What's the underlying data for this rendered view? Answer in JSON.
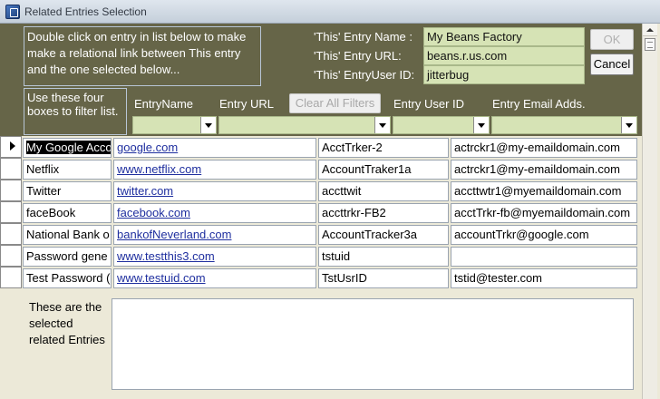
{
  "window": {
    "title": "Related Entries Selection"
  },
  "instructions": "Double click on entry in list below to make make a relational link between This entry and the one selected below...",
  "filter_note": "Use these four boxes to filter list.",
  "entry": {
    "name_label": "'This' Entry Name :",
    "name_value": "My Beans Factory",
    "url_label": "'This' Entry URL:",
    "url_value": "beans.r.us.com",
    "user_label": "'This' EntryUser ID:",
    "user_value": "jitterbug"
  },
  "buttons": {
    "ok": "OK",
    "cancel": "Cancel",
    "clear_filters": "Clear All Filters"
  },
  "columns": {
    "name": "EntryName",
    "url": "Entry URL",
    "user": "Entry User ID",
    "email": "Entry Email Adds."
  },
  "rows": [
    {
      "name": "My Google Acco",
      "url": "google.com",
      "user": "AcctTrker-2",
      "email": "actrckr1@my-emaildomain.com"
    },
    {
      "name": "Netflix",
      "url": "www.netflix.com",
      "user": "AccountTraker1a",
      "email": "actrckr1@my-emaildomain.com"
    },
    {
      "name": "Twitter",
      "url": "twitter.com",
      "user": "accttwit",
      "email": "accttwtr1@myemaildomain.com"
    },
    {
      "name": "faceBook",
      "url": "facebook.com",
      "user": "accttrkr-FB2",
      "email": "acctTrkr-fb@myemaildomain.com"
    },
    {
      "name": "National Bank o",
      "url": "bankofNeverland.com",
      "user": "AccountTracker3a",
      "email": "accountTrkr@google.com"
    },
    {
      "name": "Password gene",
      "url": "www.testthis3.com",
      "user": "tstuid",
      "email": ""
    },
    {
      "name": "Test Password (",
      "url": "www.testuid.com",
      "user": "TstUsrID",
      "email": "tstid@tester.com"
    }
  ],
  "bottom_note": "These are the selected related Entries"
}
